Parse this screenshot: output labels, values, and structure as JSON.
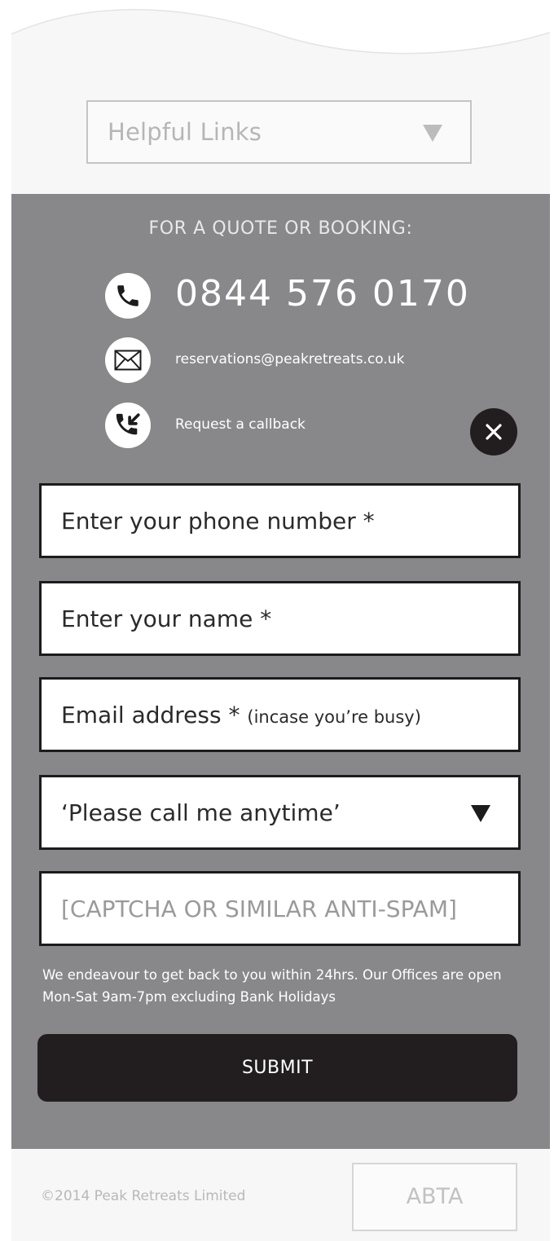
{
  "helpful_links": {
    "label": "Helpful Links"
  },
  "contact": {
    "heading": "FOR A QUOTE OR BOOKING:",
    "phone": "0844 576 0170",
    "email": "reservations@peakretreats.co.uk",
    "callback_label": "Request a callback"
  },
  "icons": {
    "phone": "phone-icon",
    "email": "envelope-icon",
    "callback": "callback-icon",
    "close": "close-icon",
    "dropdown": "triangle-down-icon"
  },
  "form": {
    "phone_placeholder": "Enter your phone number *",
    "name_placeholder": "Enter your name *",
    "email_placeholder": "Email address *",
    "email_hint": "(incase you’re busy)",
    "call_time_selected": "‘Please call me anytime’",
    "captcha_placeholder": "[CAPTCHA OR SIMILAR ANTI-SPAM]",
    "note": "We endeavour to get back to you within 24hrs. Our Offices are open Mon-Sat 9am-7pm excluding Bank Holidays",
    "submit_label": "SUBMIT"
  },
  "footer": {
    "copyright": "©2014 Peak Retreats Limited",
    "abta": "ABTA"
  },
  "colors": {
    "panel": "#88888b",
    "dark": "#221e1f",
    "page": "#f7f7f7"
  }
}
